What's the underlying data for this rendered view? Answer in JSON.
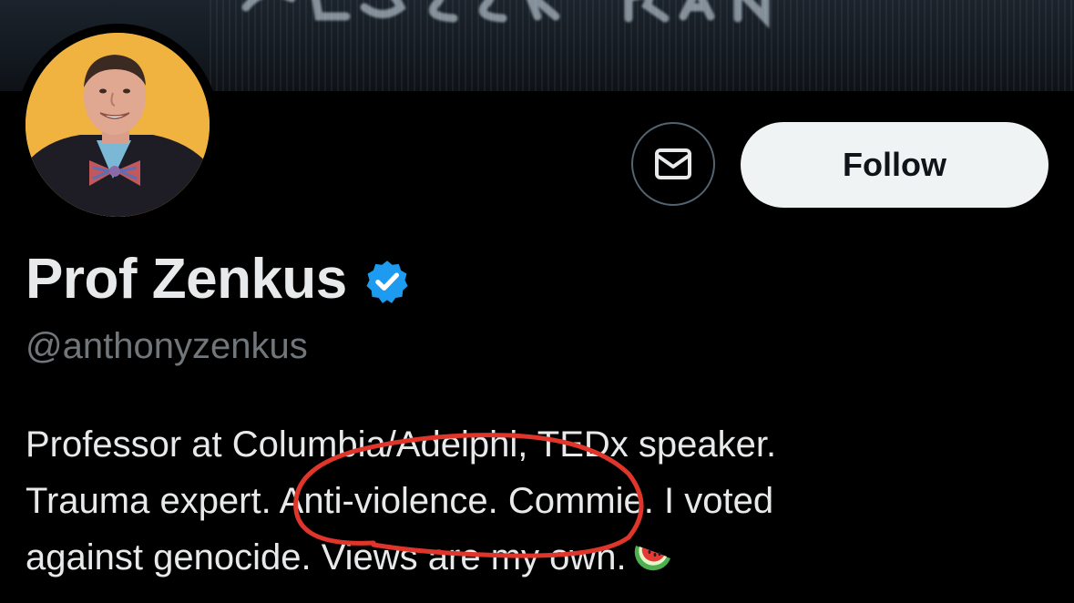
{
  "profile": {
    "display_name": "Prof Zenkus",
    "handle": "@anthonyzenkus",
    "verified": true,
    "bio_lines": [
      "Professor at Columbia/Adelphi, TEDx speaker.",
      "Trauma expert. Anti-violence. Commie. I voted",
      "against genocide. Views are my own."
    ],
    "bio_emoji": "watermelon-icon"
  },
  "actions": {
    "message_icon": "envelope-icon",
    "follow_label": "Follow"
  },
  "colors": {
    "background": "#000000",
    "avatar_background": "#f1b340",
    "verified_badge": "#1d9bf0",
    "follow_button_bg": "#eff3f4",
    "handle_text": "#71767b",
    "annotation_circle": "#e0352b"
  },
  "annotation": {
    "type": "hand-drawn-circle",
    "target": "Anti-violence."
  }
}
